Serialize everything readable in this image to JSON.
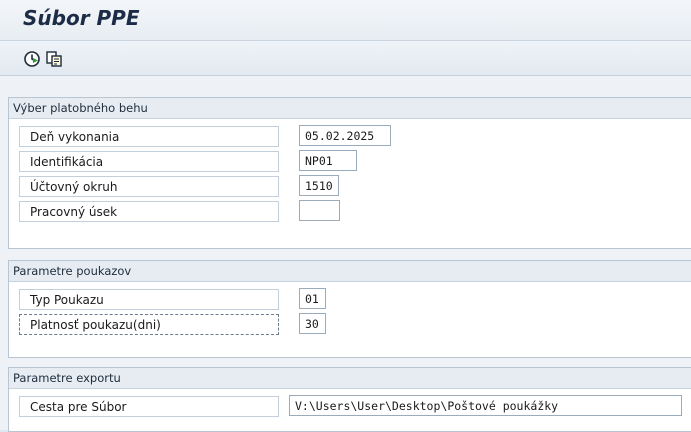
{
  "window": {
    "title": "Súbor PPE"
  },
  "toolbar": {
    "execute_icon": "execute-icon",
    "copy_icon": "copy-document-icon"
  },
  "groups": [
    {
      "title": "Výber platobného behu",
      "fields": [
        {
          "label": "Deň vykonania",
          "value": "05.02.2025"
        },
        {
          "label": "Identifikácia",
          "value": "NP01"
        },
        {
          "label": "Účtovný okruh",
          "value": "1510"
        },
        {
          "label": "Pracovný úsek",
          "value": ""
        }
      ]
    },
    {
      "title": "Parametre poukazov",
      "fields": [
        {
          "label": "Typ Poukazu",
          "value": "01"
        },
        {
          "label": "Platnosť poukazu(dni)",
          "value": "30"
        }
      ]
    },
    {
      "title": "Parametre exportu",
      "fields": [
        {
          "label": "Cesta pre Súbor",
          "value": "V:\\Users\\User\\Desktop\\Poštové poukážky"
        }
      ]
    }
  ]
}
